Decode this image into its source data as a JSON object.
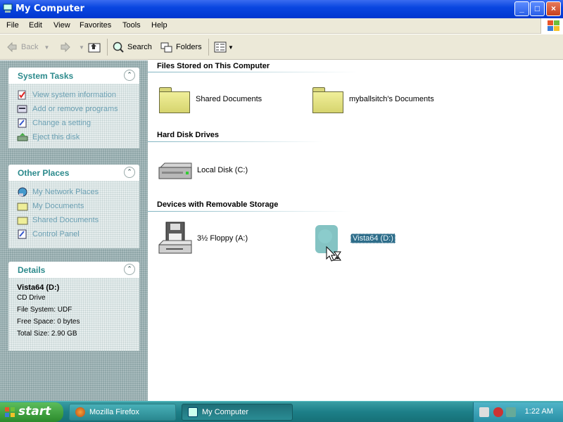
{
  "window": {
    "title": "My Computer"
  },
  "titlebar_buttons": {
    "minimize": "_",
    "maximize": "□",
    "close": "×"
  },
  "menu": [
    "File",
    "Edit",
    "View",
    "Favorites",
    "Tools",
    "Help"
  ],
  "toolbar": {
    "back": "Back",
    "search": "Search",
    "folders": "Folders"
  },
  "left": {
    "system_tasks": {
      "title": "System Tasks",
      "items": [
        "View system information",
        "Add or remove programs",
        "Change a setting",
        "Eject this disk"
      ]
    },
    "other_places": {
      "title": "Other Places",
      "items": [
        "My Network Places",
        "My Documents",
        "Shared Documents",
        "Control Panel"
      ]
    },
    "details": {
      "title": "Details",
      "name": "Vista64 (D:)",
      "type": "CD Drive",
      "file_system": "File System: UDF",
      "free_space": "Free Space: 0 bytes",
      "total_size": "Total Size: 2.90 GB"
    }
  },
  "right": {
    "groups": [
      {
        "title": "Files Stored on This Computer",
        "items": [
          "Shared Documents",
          "myballsitch's Documents"
        ]
      },
      {
        "title": "Hard Disk Drives",
        "items": [
          "Local Disk (C:)"
        ]
      },
      {
        "title": "Devices with Removable Storage",
        "items": [
          "3½ Floppy (A:)",
          "Vista64 (D:)"
        ]
      }
    ]
  },
  "taskbar": {
    "start": "start",
    "tasks": [
      "Mozilla Firefox",
      "My Computer"
    ],
    "clock": "1:22 AM"
  },
  "colors": {
    "title_bar": "#0a46e0",
    "taskbar": "#1d7f88",
    "start": "#2c8a2c",
    "panel_title": "#2c8a8c"
  }
}
